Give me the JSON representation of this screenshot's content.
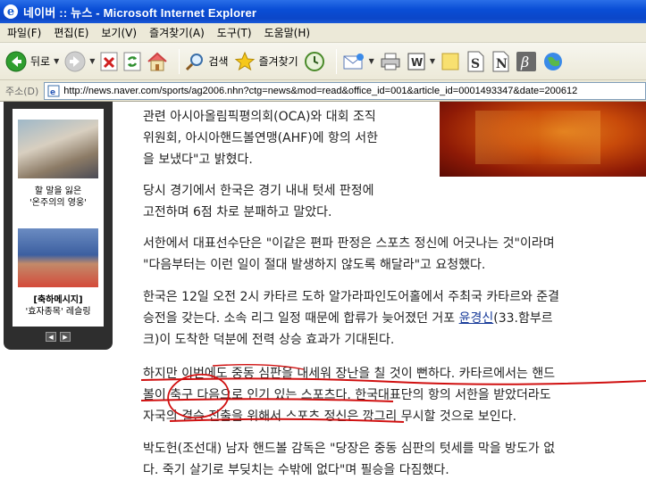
{
  "window": {
    "title": "네이버 :: 뉴스 - Microsoft Internet Explorer",
    "icon": "ie-icon"
  },
  "menu": [
    "파일(F)",
    "편집(E)",
    "보기(V)",
    "즐겨찾기(A)",
    "도구(T)",
    "도움말(H)"
  ],
  "toolbar": {
    "back_label": "뒤로",
    "search_label": "검색",
    "favorites_label": "즐겨찾기"
  },
  "address": {
    "label": "주소(D)",
    "url": "http://news.naver.com/sports/ag2006.nhn?ctg=news&mod=read&office_id=001&article_id=0001493347&date=200612"
  },
  "sidebar": {
    "item1": {
      "line1": "할 말을 잃은",
      "line2": "'온주의의 영웅'"
    },
    "item2": {
      "line1": "[축하메시지]",
      "line2": "'효자종목' 레슬링"
    }
  },
  "article": {
    "p1": [
      "관련 아시아올림픽평의회(OCA)와 대회 조직",
      "위원회, 아시아핸드볼연맹(AHF)에 항의 서한",
      "을 보냈다\"고 밝혔다."
    ],
    "p2": [
      "당시 경기에서 한국은 경기 내내 텃세 판정에",
      "고전하며 6점 차로 분패하고 말았다."
    ],
    "p3": [
      "서한에서 대표선수단은 \"이같은 편파 판정은 스포츠 정신에 어긋나는 것\"이라며",
      "\"다음부터는 이런 일이 절대 발생하지 않도록 해달라\"고 요청했다."
    ],
    "p4": {
      "line1": "한국은 12일 오전 2시 카타르 도하 알가라파인도어홀에서 주최국 카타르와 준결",
      "line2": "승전을 갖는다. 소속 리그 일정 때문에 합류가 늦어졌던 거포 ",
      "link": "윤경신",
      "line2_end": "(33.함부르",
      "line3": "크)이 도착한 덕분에 전력 상승 효과가 기대된다."
    },
    "p5": [
      "하지만 이번에도 중동 심판을 내세워 장난을 칠 것이 뻔하다. 카타르에서는 핸드",
      "볼이 축구 다음으로 인기 있는 스포츠다. 한국대표단의 항의 서한을 받았더라도",
      "자국의 결승 진출을 위해서 스포츠 정신은 깡그리 무시할 것으로 보인다."
    ],
    "p6": [
      "박도헌(조선대) 남자 핸드볼 감독은 \"당장은 중동 심판의 텃세를 막을 방도가 없",
      "다. 죽기 살기로 부딪치는 수밖에 없다\"며 필승을 다짐했다."
    ]
  },
  "colors": {
    "titlebar": "#0b46c8",
    "chrome": "#ece9d8",
    "annotation": "#d01010",
    "link": "#1a3d9a"
  }
}
